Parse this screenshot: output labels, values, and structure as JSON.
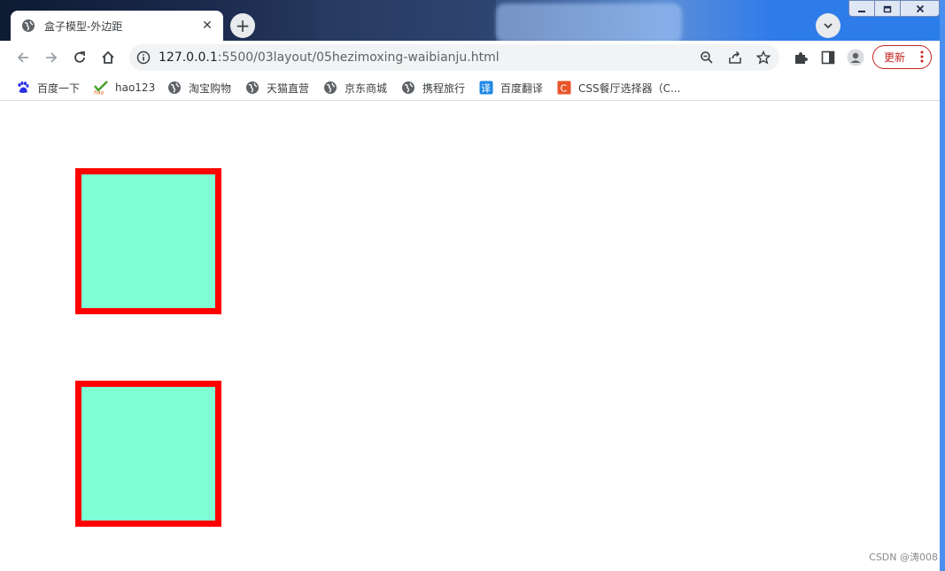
{
  "tab": {
    "title": "盒子模型-外边距",
    "close_glyph": "✕"
  },
  "new_tab_glyph": "+",
  "window_controls": [
    "minimize",
    "maximize",
    "close"
  ],
  "address_bar": {
    "host": "127.0.0.1",
    "path": ":5500/03layout/05hezimoxing-waibianju.html"
  },
  "update_button": {
    "label": "更新"
  },
  "bookmarks": [
    {
      "label": "百度一下",
      "icon": "baidu-paw-icon"
    },
    {
      "label": "hao123",
      "icon": "hao123-icon"
    },
    {
      "label": "淘宝购物",
      "icon": "globe-icon"
    },
    {
      "label": "天猫直营",
      "icon": "globe-icon"
    },
    {
      "label": "京东商城",
      "icon": "globe-icon"
    },
    {
      "label": "携程旅行",
      "icon": "globe-icon"
    },
    {
      "label": "百度翻译",
      "icon": "translate-icon"
    },
    {
      "label": "CSS餐厅选择器（C...",
      "icon": "css-c-icon"
    }
  ],
  "page": {
    "boxes": [
      {
        "fill": "#7fffd4",
        "border": "#ff0000"
      },
      {
        "fill": "#7fffd4",
        "border": "#ff0000"
      }
    ],
    "watermark": "CSDN @涛008"
  },
  "colors": {
    "accent_red": "#c5221f",
    "box_fill": "#7fffd4",
    "box_border": "#ff0000"
  }
}
